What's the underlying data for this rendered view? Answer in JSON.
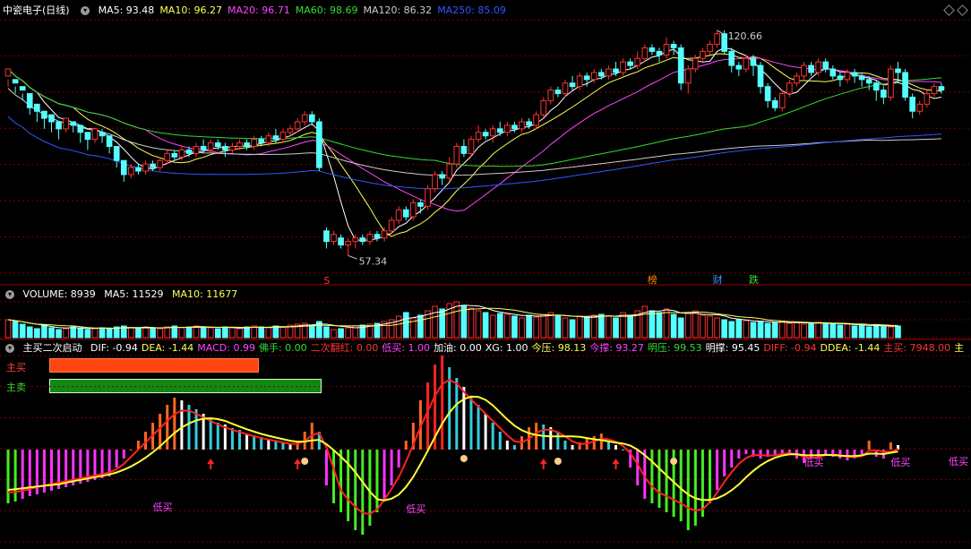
{
  "main_header": {
    "stock_name": "中瓷电子(日线)",
    "ma": [
      {
        "label": "MA5: 93.48",
        "color": "#ffffff"
      },
      {
        "label": "MA10: 96.27",
        "color": "#ffff55"
      },
      {
        "label": "MA20: 96.71",
        "color": "#ff44ff"
      },
      {
        "label": "MA60: 98.69",
        "color": "#33dd33"
      },
      {
        "label": "MA120: 86.32",
        "color": "#cccccc"
      },
      {
        "label": "MA250: 85.09",
        "color": "#3355ff"
      }
    ]
  },
  "volume_header": {
    "label": "VOLUME: 8939",
    "ma5": "MA5: 11529",
    "ma10": "MA10: 11677"
  },
  "indicator_header": {
    "name": "主买二次启动",
    "items": [
      {
        "label": "DIF: -0.94",
        "color": "#ffffff"
      },
      {
        "label": "DEA: -1.44",
        "color": "#ffff55"
      },
      {
        "label": "MACD: 0.99",
        "color": "#ff44ff"
      },
      {
        "label": "佛手: 0.00",
        "color": "#33dd33"
      },
      {
        "label": "二次翻红: 0.00",
        "color": "#ff3333"
      },
      {
        "label": "低买: 1.00",
        "color": "#ff44ff"
      },
      {
        "label": "加油: 0.00",
        "color": "#ffffff"
      },
      {
        "label": "XG: 1.00",
        "color": "#ffffff"
      },
      {
        "label": "今压: 98.13",
        "color": "#ffff55"
      },
      {
        "label": "今撑: 93.27",
        "color": "#ff44ff"
      },
      {
        "label": "明压: 99.53",
        "color": "#33dd33"
      },
      {
        "label": "明撑: 95.45",
        "color": "#ffffff"
      },
      {
        "label": "DIFF: -0.94",
        "color": "#ff3333"
      },
      {
        "label": "DDEA: -1.44",
        "color": "#ffff55"
      },
      {
        "label": "主买: 7948.00",
        "color": "#ff3333"
      },
      {
        "label": "主",
        "color": "#ffff55"
      }
    ]
  },
  "legend": {
    "buy_label": "主买",
    "sell_label": "主卖",
    "buy_fraction": 0.6,
    "sell_fraction": 0.78
  },
  "annotations": {
    "high": "120.66",
    "low": "57.34",
    "s_marker": "S",
    "bang": "榜",
    "cai": "财",
    "die": "跌",
    "dimai": "低买"
  },
  "colors": {
    "up": "#ff3232",
    "down": "#54ffff",
    "grid": "#7a0000",
    "ma5": "#ffffff",
    "ma10": "#ffff55",
    "ma20": "#ff44ff",
    "ma60": "#33dd33",
    "ma120": "#cccccc",
    "ma250": "#3355ff"
  },
  "chart_data": {
    "type": "candlestick",
    "title": "中瓷电子(日线)",
    "price_range": [
      52,
      124
    ],
    "candles": [
      [
        108,
        110,
        105,
        107
      ],
      [
        107,
        106,
        103,
        105
      ],
      [
        105,
        104,
        101,
        103
      ],
      [
        103,
        99,
        97,
        101
      ],
      [
        100,
        98,
        95,
        99
      ],
      [
        98,
        96,
        93,
        97
      ],
      [
        97,
        95,
        92,
        96
      ],
      [
        95,
        93,
        90,
        94
      ],
      [
        93,
        96,
        92,
        95
      ],
      [
        95,
        94,
        92,
        95
      ],
      [
        94,
        92,
        89,
        93
      ],
      [
        92,
        90,
        87,
        91
      ],
      [
        90,
        93,
        89,
        92
      ],
      [
        92,
        91,
        89,
        93
      ],
      [
        91,
        88,
        86,
        90
      ],
      [
        88,
        84,
        82,
        86
      ],
      [
        84,
        80,
        78,
        82
      ],
      [
        80,
        82,
        79,
        83
      ],
      [
        82,
        81,
        80,
        83
      ],
      [
        81,
        83,
        80,
        84
      ],
      [
        83,
        82,
        81,
        84
      ],
      [
        82,
        84,
        81,
        85
      ],
      [
        84,
        86,
        83,
        87
      ],
      [
        86,
        85,
        84,
        87
      ],
      [
        85,
        87,
        84,
        88
      ],
      [
        87,
        86,
        85,
        88
      ],
      [
        86,
        88,
        85,
        89
      ],
      [
        88,
        87,
        86,
        90
      ],
      [
        87,
        89,
        86,
        90
      ],
      [
        89,
        88,
        87,
        90
      ],
      [
        88,
        87,
        85,
        89
      ],
      [
        87,
        88,
        86,
        89
      ],
      [
        88,
        89,
        87,
        90
      ],
      [
        89,
        88,
        87,
        90
      ],
      [
        88,
        90,
        87,
        91
      ],
      [
        90,
        89,
        88,
        91
      ],
      [
        89,
        91,
        88,
        92
      ],
      [
        91,
        90,
        89,
        93
      ],
      [
        90,
        92,
        89,
        93
      ],
      [
        92,
        93,
        91,
        94
      ],
      [
        93,
        95,
        92,
        96
      ],
      [
        95,
        97,
        94,
        98
      ],
      [
        97,
        95,
        94,
        98
      ],
      [
        95,
        82,
        81,
        96
      ],
      [
        64,
        61,
        59,
        65
      ],
      [
        61,
        63,
        60,
        64
      ],
      [
        62,
        60,
        59,
        63
      ],
      [
        60,
        61,
        57,
        62
      ],
      [
        61,
        62,
        59,
        63
      ],
      [
        62,
        61,
        60,
        63
      ],
      [
        61,
        63,
        60,
        64
      ],
      [
        63,
        62,
        61,
        64
      ],
      [
        62,
        64,
        61,
        65
      ],
      [
        64,
        67,
        63,
        68
      ],
      [
        67,
        70,
        66,
        71
      ],
      [
        70,
        68,
        67,
        71
      ],
      [
        68,
        72,
        67,
        73
      ],
      [
        72,
        71,
        69,
        73
      ],
      [
        71,
        76,
        70,
        77
      ],
      [
        76,
        80,
        75,
        81
      ],
      [
        80,
        79,
        77,
        81
      ],
      [
        79,
        83,
        78,
        85
      ],
      [
        83,
        88,
        82,
        89
      ],
      [
        88,
        86,
        85,
        90
      ],
      [
        86,
        90,
        85,
        91
      ],
      [
        90,
        92,
        89,
        94
      ],
      [
        92,
        91,
        90,
        93
      ],
      [
        91,
        93,
        89,
        94
      ],
      [
        93,
        92,
        91,
        95
      ],
      [
        92,
        94,
        91,
        95
      ],
      [
        94,
        93,
        92,
        95
      ],
      [
        93,
        95,
        92,
        96
      ],
      [
        95,
        94,
        93,
        96
      ],
      [
        94,
        97,
        93,
        98
      ],
      [
        97,
        101,
        96,
        102
      ],
      [
        101,
        104,
        100,
        105
      ],
      [
        104,
        103,
        102,
        105
      ],
      [
        103,
        106,
        102,
        107
      ],
      [
        106,
        105,
        104,
        108
      ],
      [
        105,
        108,
        104,
        109
      ],
      [
        108,
        107,
        105,
        109
      ],
      [
        107,
        109,
        106,
        110
      ],
      [
        109,
        108,
        107,
        110
      ],
      [
        108,
        110,
        107,
        111
      ],
      [
        110,
        109,
        108,
        112
      ],
      [
        109,
        112,
        108,
        113
      ],
      [
        112,
        111,
        110,
        113
      ],
      [
        111,
        113,
        110,
        115
      ],
      [
        113,
        116,
        112,
        117
      ],
      [
        116,
        115,
        114,
        117
      ],
      [
        115,
        114,
        112,
        116
      ],
      [
        114,
        117,
        113,
        119
      ],
      [
        117,
        116,
        114,
        118
      ],
      [
        116,
        106,
        104,
        117
      ],
      [
        106,
        110,
        103,
        111
      ],
      [
        110,
        113,
        109,
        114
      ],
      [
        113,
        115,
        112,
        116
      ],
      [
        115,
        117,
        114,
        118
      ],
      [
        117,
        120,
        116,
        121
      ],
      [
        120,
        115,
        114,
        121
      ],
      [
        115,
        111,
        109,
        116
      ],
      [
        111,
        110,
        108,
        112
      ],
      [
        110,
        113,
        109,
        114
      ],
      [
        113,
        111,
        108,
        114
      ],
      [
        111,
        105,
        103,
        112
      ],
      [
        105,
        101,
        99,
        106
      ],
      [
        101,
        99,
        98,
        102
      ],
      [
        99,
        103,
        98,
        104
      ],
      [
        103,
        106,
        102,
        107
      ],
      [
        106,
        108,
        105,
        109
      ],
      [
        108,
        111,
        107,
        112
      ],
      [
        111,
        109,
        108,
        112
      ],
      [
        109,
        112,
        108,
        113
      ],
      [
        112,
        110,
        109,
        113
      ],
      [
        110,
        108,
        107,
        111
      ],
      [
        108,
        107,
        105,
        109
      ],
      [
        107,
        109,
        106,
        110
      ],
      [
        109,
        108,
        106,
        110
      ],
      [
        108,
        107,
        105,
        109
      ],
      [
        107,
        106,
        104,
        108
      ],
      [
        106,
        104,
        101,
        107
      ],
      [
        104,
        102,
        100,
        105
      ],
      [
        102,
        110,
        101,
        111
      ],
      [
        110,
        109,
        106,
        112
      ],
      [
        109,
        102,
        101,
        110
      ],
      [
        102,
        98,
        96,
        103
      ],
      [
        98,
        100,
        97,
        101
      ],
      [
        100,
        103,
        99,
        104
      ],
      [
        103,
        105,
        102,
        106
      ],
      [
        105,
        104,
        103,
        106
      ]
    ],
    "volume": [
      20,
      18,
      15,
      12,
      10,
      14,
      11,
      9,
      10,
      12,
      11,
      9,
      10,
      11,
      10,
      12,
      13,
      11,
      10,
      12,
      11,
      10,
      12,
      13,
      11,
      12,
      13,
      12,
      11,
      10,
      12,
      11,
      10,
      12,
      13,
      12,
      11,
      13,
      12,
      14,
      15,
      16,
      14,
      18,
      12,
      9,
      10,
      11,
      13,
      14,
      15,
      16,
      18,
      20,
      24,
      28,
      22,
      25,
      30,
      35,
      32,
      38,
      40,
      36,
      33,
      30,
      28,
      25,
      27,
      26,
      24,
      22,
      25,
      23,
      26,
      28,
      24,
      22,
      20,
      24,
      23,
      25,
      26,
      24,
      22,
      28,
      25,
      30,
      35,
      30,
      28,
      32,
      26,
      22,
      27,
      30,
      25,
      24,
      22,
      20,
      18,
      20,
      19,
      17,
      18,
      16,
      17,
      18,
      16,
      17,
      15,
      16,
      17,
      16,
      15,
      14,
      15,
      13,
      14,
      12,
      14,
      13,
      12,
      13
    ],
    "indicator_series": [
      -60,
      -58,
      -55,
      -52,
      -50,
      -48,
      -46,
      -44,
      -42,
      -40,
      -38,
      -36,
      -34,
      -32,
      -30,
      -20,
      -10,
      0,
      10,
      20,
      30,
      40,
      50,
      58,
      55,
      50,
      45,
      40,
      35,
      30,
      28,
      24,
      22,
      18,
      16,
      14,
      12,
      10,
      8,
      6,
      10,
      20,
      30,
      20,
      -40,
      -60,
      -70,
      -80,
      -90,
      -95,
      -85,
      -70,
      -55,
      -40,
      -20,
      10,
      30,
      55,
      75,
      95,
      105,
      92,
      80,
      70,
      60,
      50,
      40,
      30,
      20,
      10,
      5,
      15,
      25,
      30,
      28,
      25,
      20,
      10,
      5,
      8,
      12,
      15,
      18,
      10,
      5,
      0,
      -20,
      -40,
      -55,
      -60,
      -65,
      -70,
      -75,
      -80,
      -90,
      -85,
      -75,
      -60,
      -45,
      -30,
      -20,
      -10,
      -5,
      -8,
      -10,
      -8,
      -6,
      -4,
      -5,
      -10,
      -15,
      -10,
      -8,
      -5,
      -8,
      -10,
      -12,
      -10,
      -5,
      10,
      -8,
      -10,
      8,
      5
    ]
  }
}
